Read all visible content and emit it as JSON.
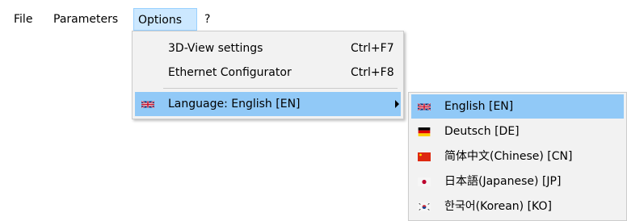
{
  "menubar": {
    "items": [
      {
        "label": "File"
      },
      {
        "label": "Parameters"
      },
      {
        "label": "Options"
      },
      {
        "label": "?"
      }
    ]
  },
  "options_menu": {
    "items": [
      {
        "label": "3D-View settings",
        "shortcut": "Ctrl+F7"
      },
      {
        "label": "Ethernet Configurator",
        "shortcut": "Ctrl+F8"
      },
      {
        "label": "Language: English [EN]",
        "icon": "uk-flag-icon",
        "has_submenu": true
      }
    ]
  },
  "language_submenu": {
    "items": [
      {
        "label": "English [EN]",
        "icon": "uk-flag-icon",
        "selected": true
      },
      {
        "label": "Deutsch [DE]",
        "icon": "germany-flag-icon"
      },
      {
        "label": "简体中文(Chinese) [CN]",
        "icon": "china-flag-icon"
      },
      {
        "label": "日本語(Japanese) [JP]",
        "icon": "japan-flag-icon"
      },
      {
        "label": "한국어(Korean) [KO]",
        "icon": "korea-flag-icon"
      }
    ]
  },
  "colors": {
    "menu_open_bg": "#cce8ff",
    "menu_highlight_bg": "#91c9f7",
    "menu_bg": "#f2f2f2"
  }
}
